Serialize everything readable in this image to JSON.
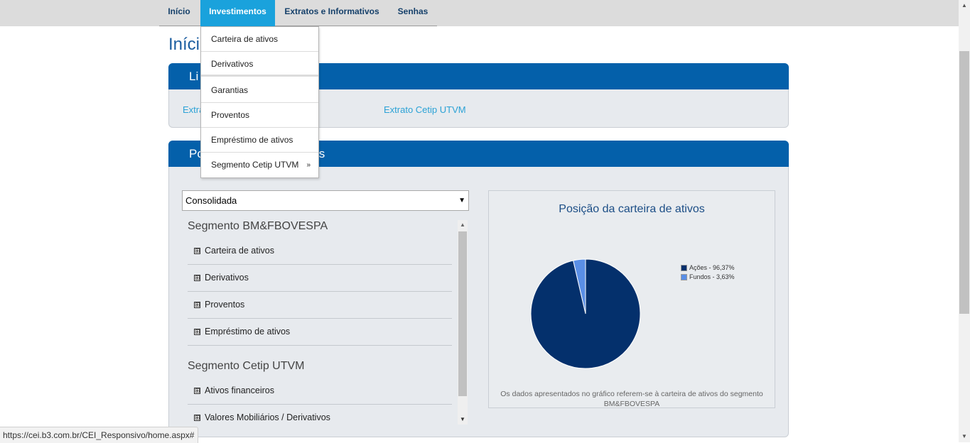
{
  "nav": {
    "items": [
      {
        "label": "Início"
      },
      {
        "label": "Investimentos"
      },
      {
        "label": "Extratos e Informativos"
      },
      {
        "label": "Senhas"
      }
    ]
  },
  "page": {
    "title": "Início"
  },
  "links_panel": {
    "header": "Li",
    "link1": "Extra",
    "link2": "Extrato Cetip UTVM"
  },
  "position_panel": {
    "header_start": "Po",
    "header_end": "s",
    "select_value": "Consolidada",
    "segments": [
      {
        "title": "Segmento BM&FBOVESPA",
        "items": [
          "Carteira de ativos",
          "Derivativos",
          "Proventos",
          "Empréstimo de ativos"
        ]
      },
      {
        "title": "Segmento Cetip UTVM",
        "items": [
          "Ativos financeiros",
          "Valores Mobiliários / Derivativos"
        ]
      }
    ]
  },
  "dropdown": {
    "items": [
      "Carteira de ativos",
      "Derivativos",
      "Garantias",
      "Proventos",
      "Empréstimo de ativos",
      "Segmento Cetip UTVM"
    ],
    "submenu_marker": "»"
  },
  "chart_data": {
    "type": "pie",
    "title": "Posição da carteira de ativos",
    "categories": [
      "Ações",
      "Fundos"
    ],
    "values": [
      96.37,
      3.63
    ],
    "legend": [
      "Ações - 96,37%",
      "Fundos - 3,63%"
    ],
    "colors": [
      "#04306c",
      "#5a8fe6"
    ],
    "legend_position": "right",
    "note": "Os dados apresentados no gráfico referem-se à carteira de ativos do segmento BM&FBOVESPA"
  },
  "status": {
    "url": "https://cei.b3.com.br/CEI_Responsivo/home.aspx#"
  },
  "icons": {
    "plus": "⊞",
    "select_arrow": "▼"
  }
}
